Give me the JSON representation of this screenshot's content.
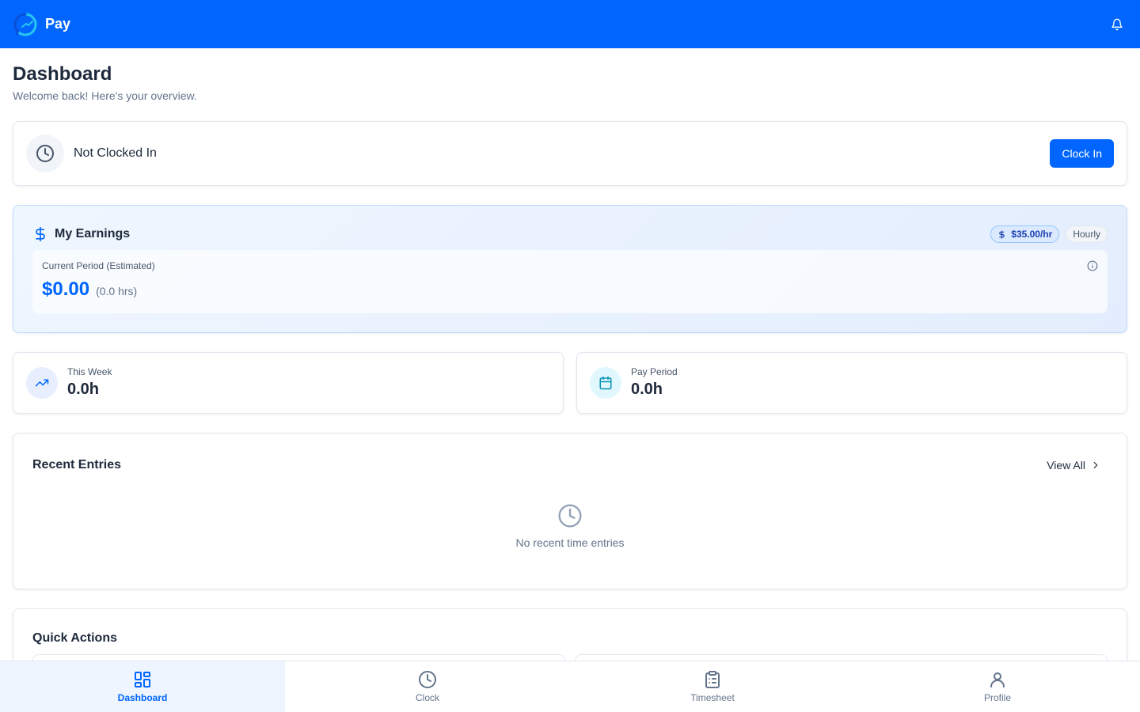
{
  "app": {
    "name": "Pay"
  },
  "page": {
    "title": "Dashboard",
    "subtitle": "Welcome back! Here's your overview."
  },
  "clock": {
    "status": "Not Clocked In",
    "button_label": "Clock In"
  },
  "earnings": {
    "title": "My Earnings",
    "rate_badge": "$35.00/hr",
    "pay_type": "Hourly",
    "period_label": "Current Period (Estimated)",
    "amount": "$0.00",
    "hours": "(0.0 hrs)"
  },
  "stats": [
    {
      "label": "This Week",
      "value": "0.0h",
      "icon": "trending-up-icon"
    },
    {
      "label": "Pay Period",
      "value": "0.0h",
      "icon": "calendar-icon"
    }
  ],
  "recent_entries": {
    "title": "Recent Entries",
    "view_all_label": "View All",
    "empty_message": "No recent time entries"
  },
  "quick_actions": {
    "title": "Quick Actions"
  },
  "bottom_nav": {
    "items": [
      {
        "label": "Dashboard",
        "icon": "dashboard-icon",
        "active": true
      },
      {
        "label": "Clock",
        "icon": "clock-icon",
        "active": false
      },
      {
        "label": "Timesheet",
        "icon": "clipboard-icon",
        "active": false
      },
      {
        "label": "Profile",
        "icon": "user-icon",
        "active": false
      }
    ]
  },
  "colors": {
    "primary": "#0066ff",
    "active_nav_bg": "#eef5ff",
    "text_dark": "#1e293b",
    "text_muted": "#64748b"
  }
}
